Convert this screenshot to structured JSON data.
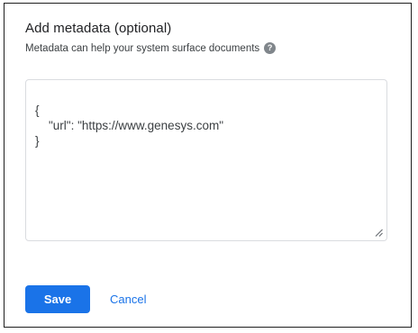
{
  "dialog": {
    "title": "Add metadata (optional)",
    "subtitle": "Metadata can help your system surface documents",
    "help_icon": "question-circle-icon",
    "editor": {
      "lines": [
        "{",
        "    \"url\": \"https://www.genesys.com\"",
        "}"
      ]
    },
    "actions": {
      "save_label": "Save",
      "cancel_label": "Cancel"
    }
  },
  "colors": {
    "primary": "#1a73e8",
    "text": "#202124",
    "border": "#dadce0",
    "icon_gray": "#80868b"
  }
}
